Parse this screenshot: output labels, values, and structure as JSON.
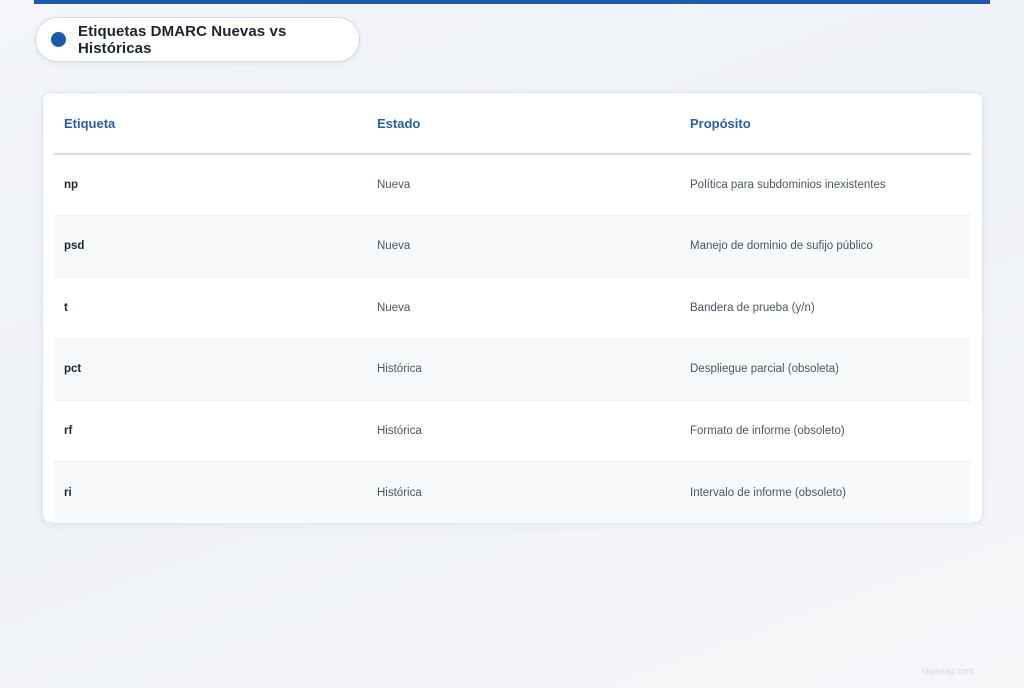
{
  "header": {
    "title": "Etiquetas DMARC Nuevas vs Históricas"
  },
  "table": {
    "columns": [
      "Etiqueta",
      "Estado",
      "Propósito"
    ],
    "rows": [
      [
        "np",
        "Nueva",
        "Política para subdominios inexistentes"
      ],
      [
        "psd",
        "Nueva",
        "Manejo de dominio de sufijo público"
      ],
      [
        "t",
        "Nueva",
        "Bandera de prueba (y/n)"
      ],
      [
        "pct",
        "Histórica",
        "Despliegue parcial (obsoleta)"
      ],
      [
        "rf",
        "Histórica",
        "Formato de informe (obsoleto)"
      ],
      [
        "ri",
        "Histórica",
        "Intervalo de informe (obsoleto)"
      ]
    ]
  },
  "watermark": "skysnag.com",
  "colors": {
    "accent": "#1e5aa8",
    "header_text": "#2a5f9e"
  }
}
